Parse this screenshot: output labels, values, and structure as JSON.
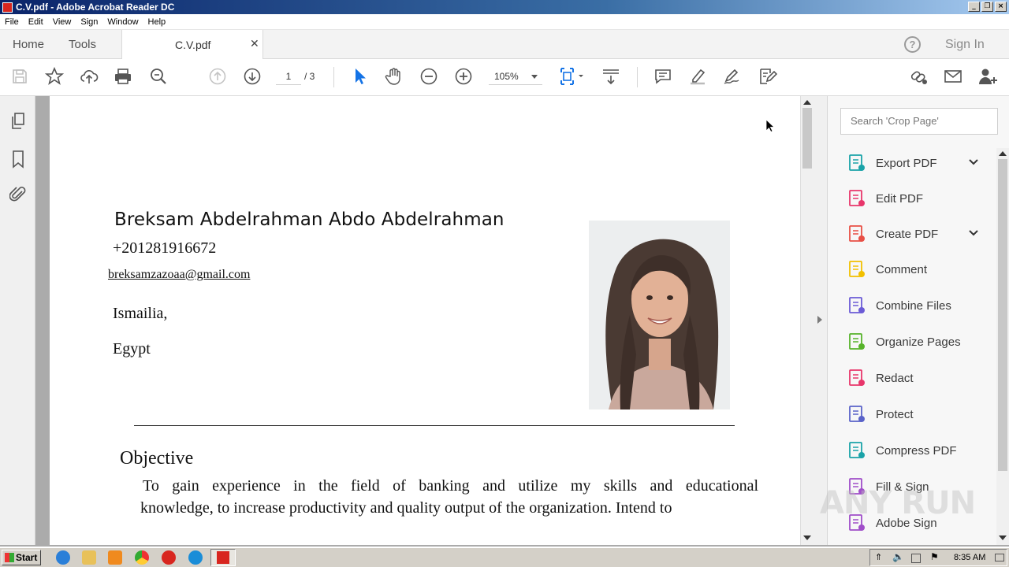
{
  "window": {
    "title": "C.V.pdf - Adobe Acrobat Reader DC"
  },
  "menu": [
    "File",
    "Edit",
    "View",
    "Sign",
    "Window",
    "Help"
  ],
  "tabs": {
    "home": "Home",
    "tools": "Tools",
    "document": "C.V.pdf"
  },
  "header": {
    "sign_in": "Sign In",
    "help": "?"
  },
  "toolbar": {
    "page_current": "1",
    "page_total": "/ 3",
    "zoom": "105%"
  },
  "right_pane": {
    "search_placeholder": "Search 'Crop Page'",
    "tools": [
      {
        "label": "Export PDF",
        "icon": "export-pdf-icon",
        "color": "#1aa3a8",
        "expand": true
      },
      {
        "label": "Edit PDF",
        "icon": "edit-pdf-icon",
        "color": "#e8366b",
        "expand": false
      },
      {
        "label": "Create PDF",
        "icon": "create-pdf-icon",
        "color": "#e84f45",
        "expand": true
      },
      {
        "label": "Comment",
        "icon": "comment-icon",
        "color": "#f2c000",
        "expand": false
      },
      {
        "label": "Combine Files",
        "icon": "combine-files-icon",
        "color": "#6b5bd6",
        "expand": false
      },
      {
        "label": "Organize Pages",
        "icon": "organize-pages-icon",
        "color": "#57b32b",
        "expand": false
      },
      {
        "label": "Redact",
        "icon": "redact-icon",
        "color": "#e8366b",
        "expand": false
      },
      {
        "label": "Protect",
        "icon": "protect-icon",
        "color": "#5a63c9",
        "expand": false
      },
      {
        "label": "Compress PDF",
        "icon": "compress-pdf-icon",
        "color": "#1aa3a8",
        "expand": false
      },
      {
        "label": "Fill & Sign",
        "icon": "fill-sign-icon",
        "color": "#a04ec9",
        "expand": false
      },
      {
        "label": "Adobe Sign",
        "icon": "adobe-sign-icon",
        "color": "#a04ec9",
        "expand": false
      }
    ]
  },
  "document": {
    "name": "Breksam Abdelrahman Abdo Abdelrahman",
    "phone": "+201281916672",
    "email": "breksamzazoaa@gmail.com",
    "city": "Ismailia,",
    "country": "Egypt",
    "section_title": "Objective",
    "objective_line1": "To gain experience in the field of banking and utilize my skills and educational",
    "objective_line2": "knowledge, to increase productivity and quality output of the organization. Intend to"
  },
  "watermark": "ANY RUN",
  "taskbar": {
    "start": "Start",
    "time": "8:35 AM"
  }
}
